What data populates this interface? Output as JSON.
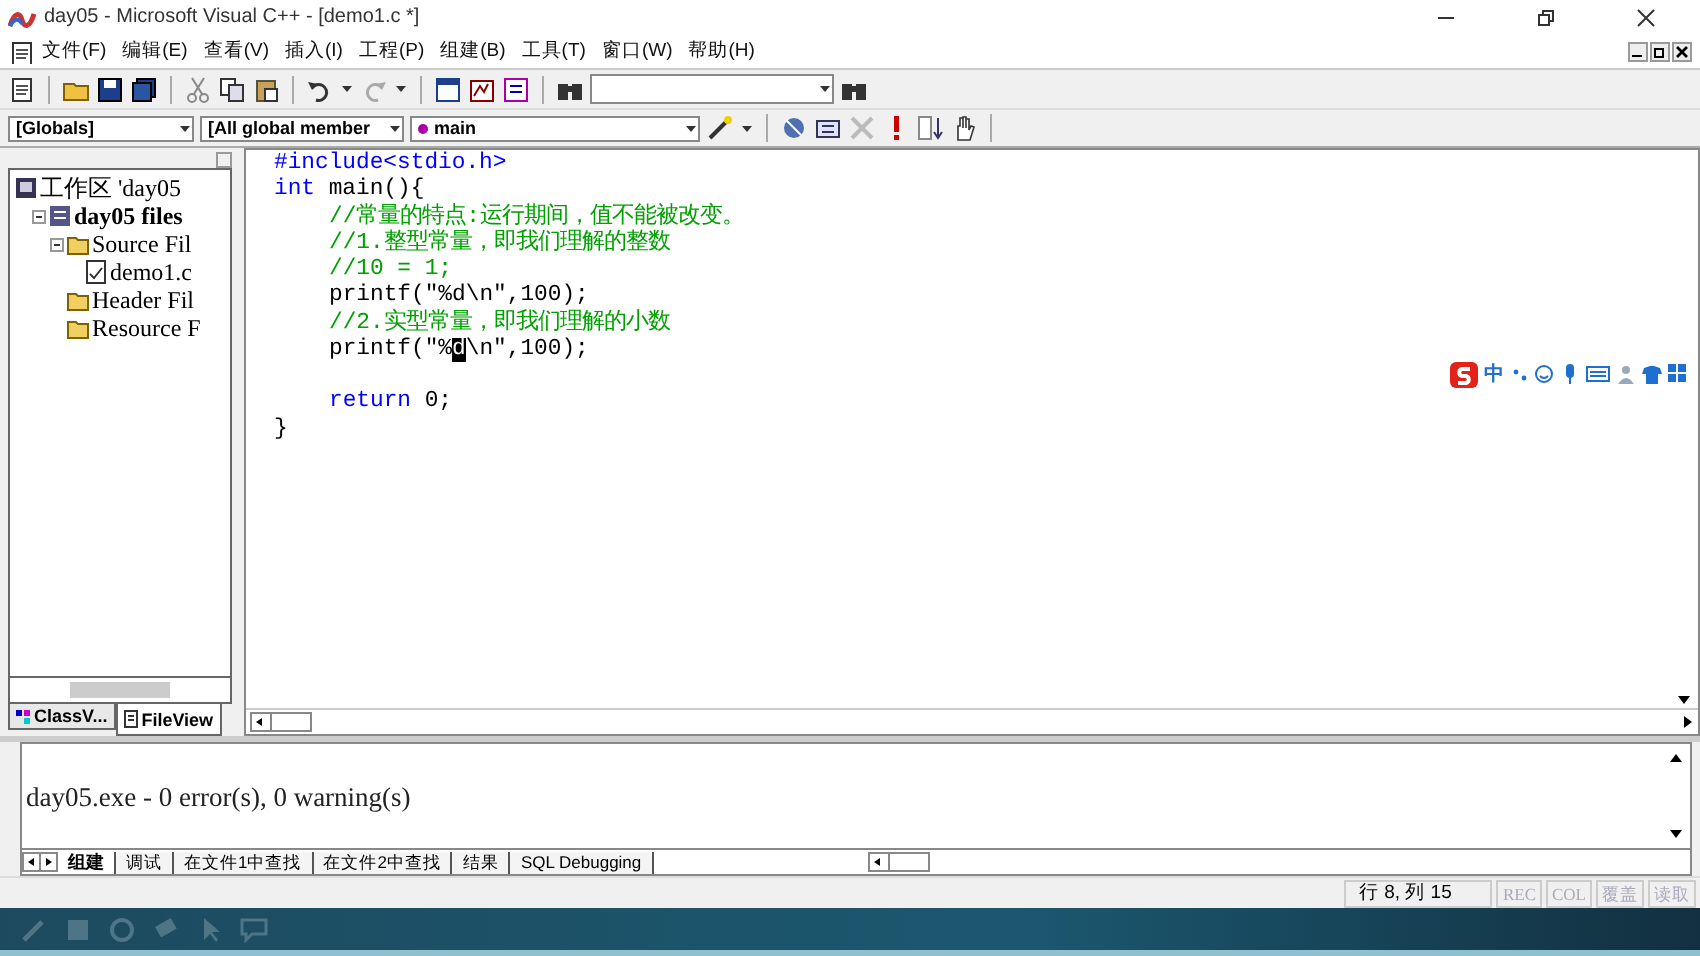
{
  "window": {
    "title": "day05 - Microsoft Visual C++ - [demo1.c *]"
  },
  "menu": [
    {
      "label": "文件(F)"
    },
    {
      "label": "编辑(E)"
    },
    {
      "label": "查看(V)"
    },
    {
      "label": "插入(I)"
    },
    {
      "label": "工程(P)"
    },
    {
      "label": "组建(B)"
    },
    {
      "label": "工具(T)"
    },
    {
      "label": "窗口(W)"
    },
    {
      "label": "帮助(H)"
    }
  ],
  "wizard_bar": {
    "class_combo": "[Globals]",
    "filter_combo": "[All global member",
    "member_combo": "main"
  },
  "workspace": {
    "tree": [
      {
        "label": "工作区 'day05",
        "children": [
          {
            "label": "day05 files",
            "children": [
              {
                "label": "Source Fil",
                "children": [
                  {
                    "label": "demo1.c"
                  }
                ]
              },
              {
                "label": "Header Fil"
              },
              {
                "label": "Resource F"
              }
            ]
          }
        ]
      }
    ],
    "tabs": [
      {
        "label": "ClassV...",
        "selected": false
      },
      {
        "label": "FileView",
        "selected": true
      }
    ]
  },
  "editor": {
    "lines": [
      {
        "kind": "text",
        "indented": false,
        "tokens": [
          {
            "kind": "keyword",
            "text": "#include<stdio.h>"
          }
        ]
      },
      {
        "kind": "text",
        "indented": false,
        "tokens": [
          {
            "kind": "keyword",
            "text": "int"
          },
          {
            "kind": "code",
            "text": " main(){"
          }
        ]
      },
      {
        "kind": "text",
        "indented": true,
        "tokens": [
          {
            "kind": "comment",
            "text": "//常量的特点:运行期间，值不能被改变。"
          }
        ]
      },
      {
        "kind": "text",
        "indented": true,
        "tokens": [
          {
            "kind": "comment",
            "text": "//1.整型常量，即我们理解的整数"
          }
        ]
      },
      {
        "kind": "text",
        "indented": true,
        "tokens": [
          {
            "kind": "comment",
            "text": "//10 = 1;"
          }
        ]
      },
      {
        "kind": "text",
        "indented": true,
        "tokens": [
          {
            "kind": "code",
            "text": "printf(\"%d\\n\",100);"
          }
        ]
      },
      {
        "kind": "text",
        "indented": true,
        "tokens": [
          {
            "kind": "comment",
            "text": "//2.实型常量，即我们理解的小数"
          }
        ]
      },
      {
        "kind": "text",
        "indented": true,
        "tokens": [
          {
            "kind": "code",
            "text": "printf(\"%"
          },
          {
            "kind": "selected",
            "text": "d"
          },
          {
            "kind": "code",
            "text": "\\n\",100);"
          }
        ]
      },
      {
        "kind": "blank"
      },
      {
        "kind": "text",
        "indented": true,
        "tokens": [
          {
            "kind": "keyword",
            "text": "return"
          },
          {
            "kind": "code",
            "text": " 0;"
          }
        ]
      },
      {
        "kind": "text",
        "indented": false,
        "tokens": [
          {
            "kind": "code",
            "text": "}"
          }
        ]
      }
    ]
  },
  "ime_bar": {
    "mode": "中"
  },
  "output": {
    "text": "day05.exe - 0 error(s), 0 warning(s)",
    "tabs": [
      {
        "label": "组建",
        "selected": true
      },
      {
        "label": "调试",
        "selected": false
      },
      {
        "label": "在文件1中查找",
        "selected": false
      },
      {
        "label": "在文件2中查找",
        "selected": false
      },
      {
        "label": "结果",
        "selected": false
      },
      {
        "label": "SQL Debugging",
        "selected": false
      }
    ]
  },
  "status_bar": {
    "position": "行 8, 列 15",
    "indicators": [
      {
        "label": "REC",
        "disabled": true
      },
      {
        "label": "COL",
        "disabled": true
      },
      {
        "label": "覆盖",
        "disabled": true
      },
      {
        "label": "读取",
        "disabled": true
      }
    ]
  }
}
